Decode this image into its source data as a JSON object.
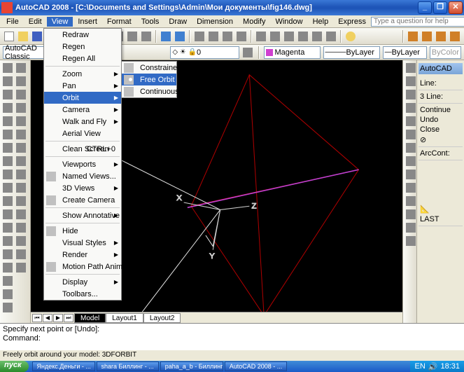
{
  "window": {
    "app": "AutoCAD 2008",
    "title_full": "AutoCAD 2008 - [C:\\Documents and Settings\\Admin\\Мои документы\\fig146.dwg]",
    "min_label": "_",
    "restore_label": "❐",
    "close_label": "✕"
  },
  "menubar": {
    "items": [
      "File",
      "Edit",
      "View",
      "Insert",
      "Format",
      "Tools",
      "Draw",
      "Dimension",
      "Modify",
      "Window",
      "Help",
      "Express"
    ],
    "open_index": 2,
    "search_placeholder": "Type a question for help"
  },
  "workspace": {
    "label": "AutoCAD Classic"
  },
  "layer_combo": "0",
  "color_combo": "Magenta",
  "linetype_combo": "ByLayer",
  "lineweight_combo": "ByLayer",
  "plotstyle_combo": "ByColor",
  "view_menu": {
    "items": [
      {
        "label": "Redraw"
      },
      {
        "label": "Regen"
      },
      {
        "label": "Regen All"
      },
      {
        "sep": true
      },
      {
        "label": "Zoom",
        "sub": true
      },
      {
        "label": "Pan",
        "sub": true
      },
      {
        "label": "Orbit",
        "sub": true,
        "hl": true
      },
      {
        "label": "Camera",
        "sub": true
      },
      {
        "label": "Walk and Fly",
        "sub": true
      },
      {
        "label": "Aerial View"
      },
      {
        "sep": true
      },
      {
        "label": "Clean Screen",
        "accel": "CTRL+0"
      },
      {
        "sep": true
      },
      {
        "label": "Viewports",
        "sub": true
      },
      {
        "label": "Named Views...",
        "icon": true
      },
      {
        "label": "3D Views",
        "sub": true
      },
      {
        "label": "Create Camera",
        "icon": true
      },
      {
        "sep": true
      },
      {
        "label": "Show Annotative Objects",
        "sub": true
      },
      {
        "sep": true
      },
      {
        "label": "Hide",
        "icon": true
      },
      {
        "label": "Visual Styles",
        "sub": true
      },
      {
        "label": "Render",
        "sub": true
      },
      {
        "label": "Motion Path Animations...",
        "icon": true
      },
      {
        "sep": true
      },
      {
        "label": "Display",
        "sub": true
      },
      {
        "label": "Toolbars..."
      }
    ]
  },
  "orbit_submenu": {
    "items": [
      {
        "label": "Constrained Orbit",
        "icon": true
      },
      {
        "label": "Free Orbit",
        "icon": true,
        "hl": true
      },
      {
        "label": "Continuous Orbit",
        "icon": true
      }
    ]
  },
  "history": {
    "header": "AutoCAD",
    "group1": [
      "Line:"
    ],
    "group2": [
      "3 Line:"
    ],
    "group3": [
      "Continue",
      "Undo",
      "Close"
    ],
    "arccont": "ArcCont:",
    "last": "LAST"
  },
  "tabs": {
    "model": "Model",
    "layout1": "Layout1",
    "layout2": "Layout2"
  },
  "canvas": {
    "x_label": "X",
    "y_label": "Y",
    "z_label": "Z"
  },
  "command": {
    "line1": "Specify next point or [Undo]:",
    "line2": "Command:"
  },
  "statusbar": "Freely orbit around your model: 3DFORBIT",
  "taskbar": {
    "start": "пуск",
    "buttons": [
      "Яндекс.Деньги - ...",
      "shara Биллинг - ...",
      "paha_a_b - Биллинг",
      "AutoCAD 2008 - ..."
    ],
    "lang": "EN",
    "clock": "18:31"
  },
  "colors": {
    "accent": "#316ac5",
    "canvas_bg": "#000000",
    "red_line": "#aa0000",
    "magenta_line": "#c040d0",
    "white_line": "#e0e0e0"
  }
}
